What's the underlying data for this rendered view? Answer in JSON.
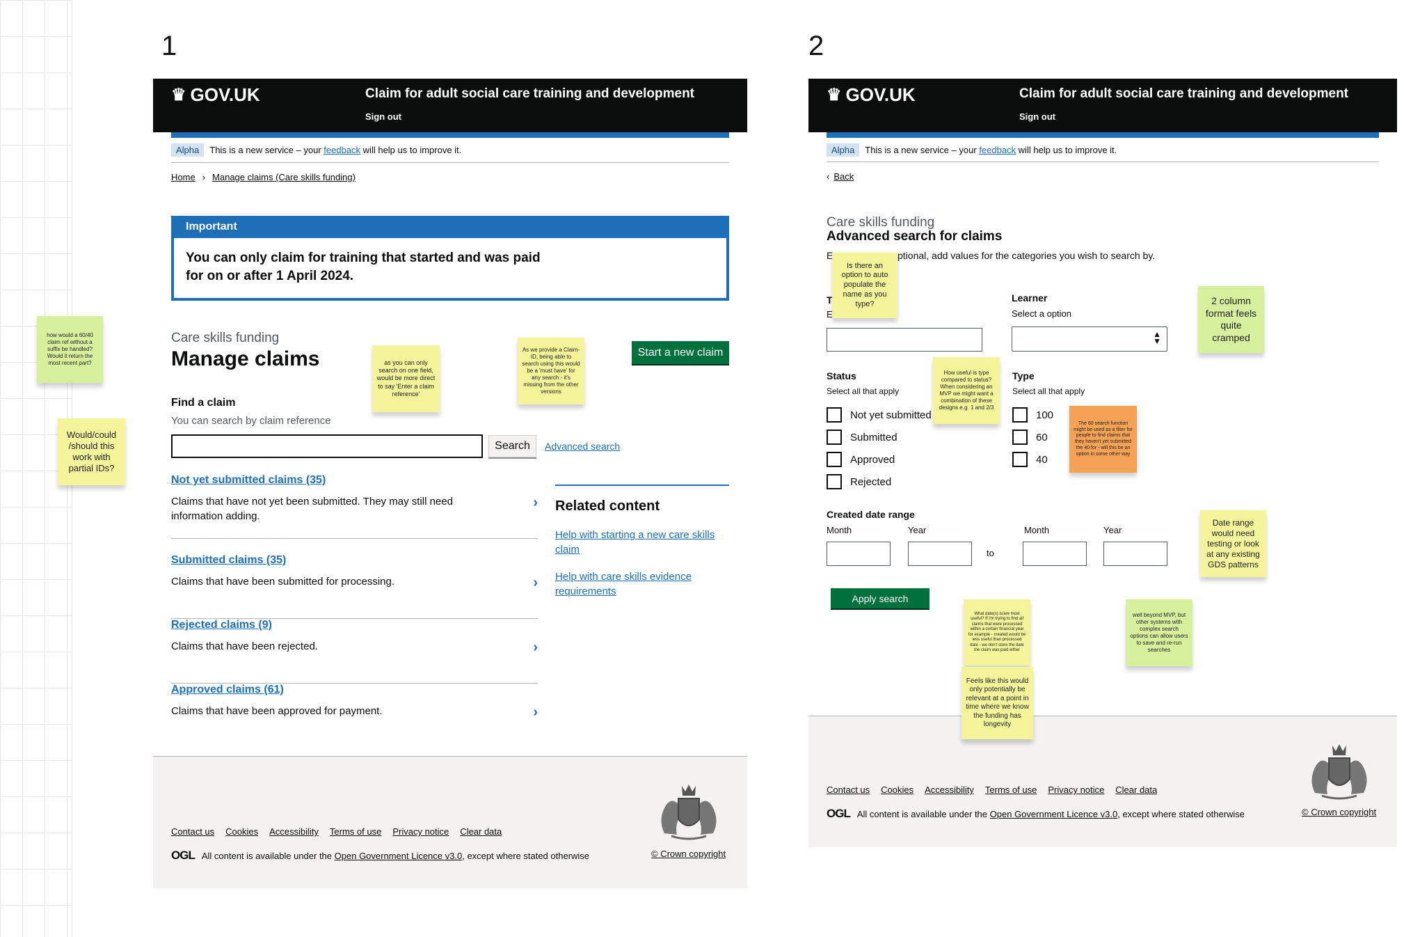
{
  "frames": [
    {
      "number": "1",
      "header": {
        "logo": "GOV.UK",
        "service_name": "Claim for adult social care training and development",
        "sign_out": "Sign out"
      },
      "phase_banner": {
        "tag": "Alpha",
        "text_before": "This is a new service – your",
        "link": "feedback",
        "text_after": "will help us to improve it."
      },
      "breadcrumbs": [
        "Home",
        "Manage claims (Care skills funding)"
      ],
      "important": {
        "title": "Important",
        "body": "You can only claim for training that started and was paid for on or after 1 April 2024."
      },
      "caption": "Care skills funding",
      "title": "Manage claims",
      "start_button": "Start a new claim",
      "find": {
        "label": "Find a claim",
        "hint": "You can search by claim reference",
        "value": "",
        "search_button": "Search",
        "advanced_link": "Advanced search"
      },
      "claims": [
        {
          "link": "Not yet submitted claims (35)",
          "desc": "Claims that have not yet been submitted. They may still need information adding."
        },
        {
          "link": "Submitted claims (35)",
          "desc": "Claims that have been submitted for processing."
        },
        {
          "link": "Rejected claims (9)",
          "desc": "Claims that have been rejected."
        },
        {
          "link": "Approved claims (61)",
          "desc": "Claims that have been approved for payment."
        }
      ],
      "related": {
        "title": "Related content",
        "links": [
          "Help with starting a new care skills claim",
          "Help with care skills evidence requirements"
        ]
      },
      "footer": {
        "links": [
          "Contact us",
          "Cookies",
          "Accessibility",
          "Terms of use",
          "Privacy notice",
          "Clear data"
        ],
        "ogl": "OGL",
        "licence_before": "All content is available under the",
        "licence_link": "Open Government Licence v3.0",
        "licence_after": ", except where stated otherwise",
        "copyright": "© Crown copyright"
      }
    },
    {
      "number": "2",
      "header": {
        "logo": "GOV.UK",
        "service_name": "Claim for adult social care training and development",
        "sign_out": "Sign out"
      },
      "phase_banner": {
        "tag": "Alpha",
        "text_before": "This is a new service – your",
        "link": "feedback",
        "text_after": "will help us to improve it."
      },
      "back": "Back",
      "caption": "Care skills funding",
      "title": "Advanced search for claims",
      "intro_start": "E",
      "intro_end": "ptional, add values for the categories you wish to search by.",
      "learner": {
        "label": "Learner",
        "hint": "Select a option",
        "value": ""
      },
      "left_field": {
        "label_initial": "T",
        "hint_initial": "E",
        "value": ""
      },
      "status": {
        "label": "Status",
        "hint": "Select all that apply",
        "options": [
          "Not yet submitted",
          "Submitted",
          "Approved",
          "Rejected"
        ]
      },
      "type": {
        "label": "Type",
        "hint": "Select all that apply",
        "options": [
          "100",
          "60",
          "40"
        ]
      },
      "date_range": {
        "label": "Created date range",
        "month": "Month",
        "year": "Year",
        "to": "to"
      },
      "apply_button": "Apply search",
      "footer": {
        "links": [
          "Contact us",
          "Cookies",
          "Accessibility",
          "Terms of use",
          "Privacy notice",
          "Clear data"
        ],
        "ogl": "OGL",
        "licence_before": "All content is available under the",
        "licence_link": "Open Government Licence v3.0",
        "licence_after": ", except where stated otherwise",
        "copyright": "© Crown copyright"
      }
    }
  ],
  "stickies": [
    "how would a 60/40 claim ref without a suffix be handled? Would it return the most recent part?",
    "Would/could /should this work with partial IDs?",
    "as you can only search on one field, would be more direct to say 'Enter a claim reference'",
    "As we provide a Claim-ID, being able to search using this would be a 'must have' for any search - it's missing from the other versions",
    "Is there an option to auto populate the name as you type?",
    "2 column format feels quite cramped",
    "How useful is type compared to status? When considering an MVP we might want a combination of these designs e.g. 1 and 2/3",
    "The 60 search function might be used as a filter for people to find claims that they haven't yet submitted the 40 for - will this be an option in some other way",
    "Date range would need testing or look at any existing GDS patterns",
    "What date(s) is/are most useful? If I'm trying to find all claims that were processed within a certain financial year for example - created would be less useful than processed date - we don't store the date the claim was paid either",
    "well beyond MVP, but other systems with complex search options can allow users to save and re-run searches",
    "Feels like this would only potentially be relevant at a point in time where we know the funding has longevity"
  ],
  "colors": {
    "header": "#0b0c0c",
    "blue": "#1d70b8",
    "green_button": "#00703c",
    "footer_bg": "#f3f2f1",
    "sticky_yellow": "#f4f49a",
    "sticky_green": "#d7f09d",
    "sticky_orange": "#f5a256"
  },
  "icons": [
    "crown-icon",
    "chevron-right-icon",
    "chevron-left-icon",
    "royal-coat-of-arms-icon",
    "select-arrows-icon"
  ]
}
